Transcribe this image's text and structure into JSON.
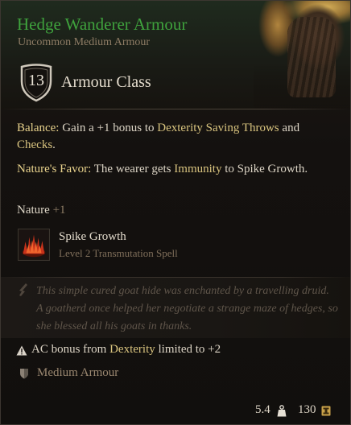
{
  "item": {
    "name": "Hedge Wanderer Armour",
    "type": "Uncommon Medium Armour",
    "rarity_color": "#3fa23d",
    "image_icon": "fur-armour-icon"
  },
  "armour_class": {
    "value": "13",
    "label": "Armour Class",
    "icon": "shield-icon"
  },
  "properties": {
    "balance": {
      "label": "Balance:",
      "text_1": " Gain a +1 bonus to ",
      "kw_1": "Dexterity",
      "text_2": " ",
      "kw_2": "Saving Throws",
      "text_3": " and ",
      "kw_3": "Checks",
      "text_4": "."
    },
    "natures_favor": {
      "label": "Nature's Favor:",
      "text_1": " The wearer gets ",
      "kw_1": "Immunity",
      "text_2": " to Spike Growth."
    },
    "skill": {
      "name": "Nature",
      "bonus": "+1"
    }
  },
  "spell": {
    "name": "Spike Growth",
    "subtitle": "Level 2 Transmutation Spell",
    "icon": "spike-growth-icon"
  },
  "lore": {
    "text": "This simple cured goat hide was enchanted by a travelling druid. A goatherd once helped her negotiate a strange maze of hedges, so she blessed all his goats in thanks.",
    "icon": "quill-icon"
  },
  "limit": {
    "text_1": "AC bonus from ",
    "kw": "Dexterity",
    "text_2": " limited to +2",
    "icon": "warning-icon"
  },
  "proficiency": {
    "label": "Medium Armour",
    "icon": "medium-armour-icon"
  },
  "footer": {
    "weight": "5.4",
    "weight_icon": "weight-icon",
    "price": "130",
    "price_icon": "gold-coin-icon"
  },
  "colors": {
    "keyword": "#d9c47f",
    "label": "#e8d28c",
    "lore": "#5f554a"
  }
}
